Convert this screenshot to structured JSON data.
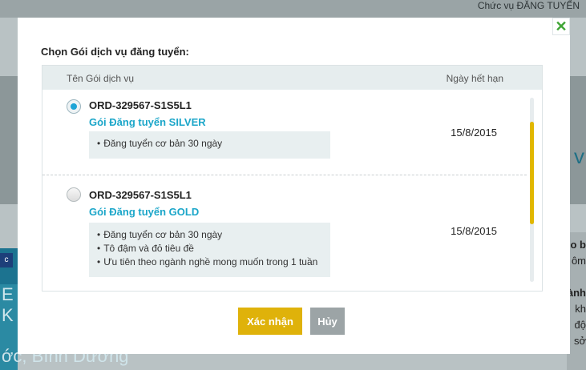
{
  "background": {
    "top_text": "Chức vụ   ĐĂNG TUYỂN",
    "hero_text": "ý v",
    "small_button": "c",
    "teal_block_text": "E\nK",
    "location": "ớc, Bình Dương",
    "right_texts": [
      "o b",
      "ôm",
      "ành",
      "kh",
      "độ",
      "sở"
    ]
  },
  "modal": {
    "title": "Chọn Gói dịch vụ đăng tuyển:",
    "close_label": "✕",
    "columns": {
      "name": "Tên Gói dịch vụ",
      "expiry": "Ngày hết hạn"
    },
    "packages": [
      {
        "order_code": "ORD-329567-S1S5L1",
        "package_name": "Gói Đăng tuyển SILVER",
        "features": [
          "Đăng tuyển cơ bản 30 ngày"
        ],
        "expiry": "15/8/2015",
        "selected": true
      },
      {
        "order_code": "ORD-329567-S1S5L1",
        "package_name": "Gói Đăng tuyển GOLD",
        "features": [
          "Đăng tuyển cơ bản 30 ngày",
          "Tô đậm và đỏ tiêu đề",
          "Ưu tiên theo ngành nghề mong muốn trong 1 tuần"
        ],
        "expiry": "15/8/2015",
        "selected": false
      }
    ],
    "confirm_label": "Xác nhận",
    "cancel_label": "Hủy"
  },
  "colors": {
    "accent_yellow": "#dfb20a",
    "package_name_blue": "#1ba6c9",
    "radio_selected": "#1ea4d6",
    "close_green": "#3fa535"
  }
}
